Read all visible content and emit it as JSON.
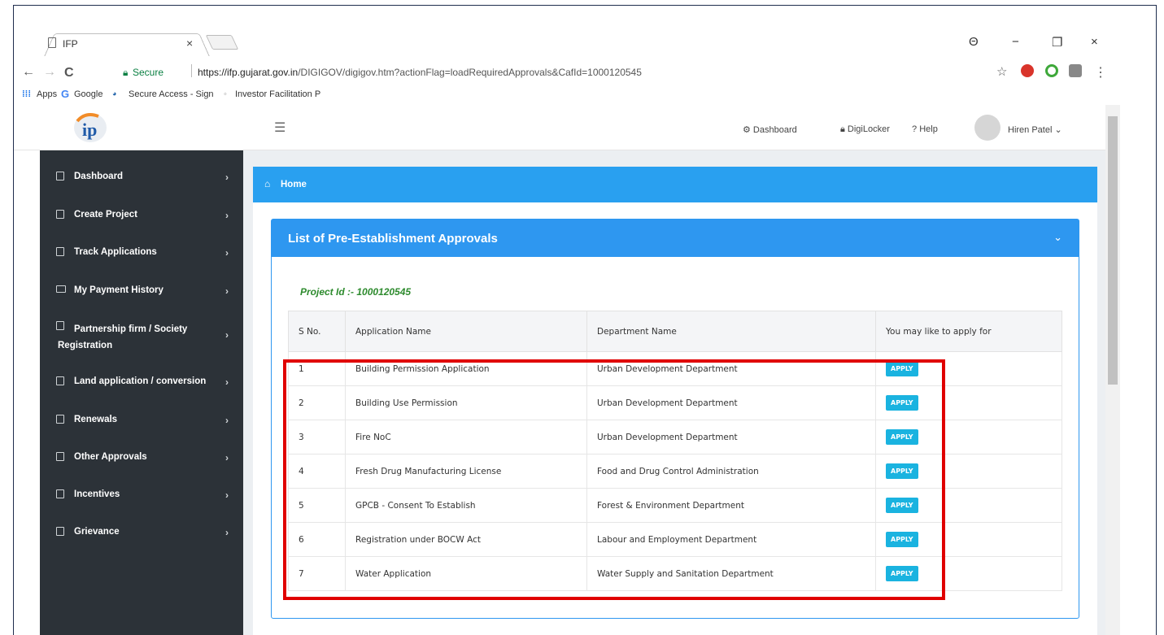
{
  "browser": {
    "tab_title": "IFP",
    "tab_close": "×",
    "secure_label": "Secure",
    "url_host": "https://ifp.gujarat.gov.in",
    "url_path": "/DIGIGOV/digigov.htm?actionFlag=loadRequiredApprovals&CafId=1000120545",
    "nav_back": "←",
    "nav_forward": "→",
    "nav_reload": "C",
    "star": "☆",
    "menu": "⋮",
    "window_controls": [
      "−",
      "❐",
      "×"
    ],
    "account_glyph": "Θ"
  },
  "bookmarks": [
    {
      "label": "Apps",
      "icon": "apps-grid-icon"
    },
    {
      "label": "Google",
      "icon": "google-icon"
    },
    {
      "label": "Secure Access - Sign",
      "icon": "tata-icon"
    },
    {
      "label": "Investor Facilitation P",
      "icon": "globe-icon"
    }
  ],
  "header": {
    "logo_text": "ip",
    "nav": [
      {
        "label": "Dashboard",
        "icon": "dashboard-icon"
      },
      {
        "label": "DigiLocker",
        "icon": "lock-icon"
      },
      {
        "label": "Help",
        "icon": "help-icon"
      }
    ],
    "user_name": "Hiren Patel"
  },
  "sidebar": {
    "items": [
      {
        "label": "Dashboard"
      },
      {
        "label": "Create Project"
      },
      {
        "label": "Track Applications"
      },
      {
        "label": "My Payment History"
      },
      {
        "label": "Partnership firm / Society Registration"
      },
      {
        "label": "Land application / conversion"
      },
      {
        "label": "Renewals"
      },
      {
        "label": "Other Approvals"
      },
      {
        "label": "Incentives"
      },
      {
        "label": "Grievance"
      }
    ]
  },
  "breadcrumb": {
    "home": "Home"
  },
  "panel": {
    "title": "List of Pre-Establishment Approvals",
    "project_id": "Project Id :- 1000120545"
  },
  "table": {
    "headers": [
      "S No.",
      "Application Name",
      "Department Name",
      "You may like to apply for"
    ],
    "rows": [
      {
        "sno": "1",
        "app": "Building Permission Application",
        "dept": "Urban Development Department",
        "action": "APPLY"
      },
      {
        "sno": "2",
        "app": "Building Use Permission",
        "dept": "Urban Development Department",
        "action": "APPLY"
      },
      {
        "sno": "3",
        "app": "Fire NoC",
        "dept": "Urban Development Department",
        "action": "APPLY"
      },
      {
        "sno": "4",
        "app": "Fresh Drug Manufacturing License",
        "dept": "Food and Drug Control Administration",
        "action": "APPLY"
      },
      {
        "sno": "5",
        "app": "GPCB - Consent To Establish",
        "dept": "Forest & Environment Department",
        "action": "APPLY"
      },
      {
        "sno": "6",
        "app": "Registration under BOCW Act",
        "dept": "Labour and Employment Department",
        "action": "APPLY"
      },
      {
        "sno": "7",
        "app": "Water Application",
        "dept": "Water Supply and Sanitation Department",
        "action": "APPLY"
      }
    ]
  },
  "colors": {
    "sidebar_bg": "#2c3238",
    "primary_blue": "#2e97f0",
    "apply_button": "#1ab3e0",
    "project_id_green": "#2e8b2e",
    "highlight_red": "#e00000"
  }
}
